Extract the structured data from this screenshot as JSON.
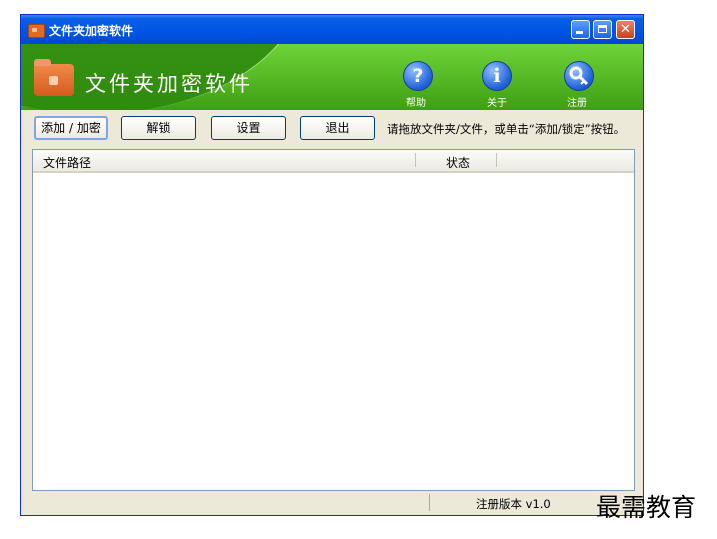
{
  "window": {
    "title": "文件夹加密软件"
  },
  "banner": {
    "title": "文件夹加密软件",
    "help_label": "帮助",
    "about_label": "关于",
    "register_label": "注册"
  },
  "toolbar": {
    "add_encrypt_label": "添加 / 加密",
    "unlock_label": "解锁",
    "settings_label": "设置",
    "exit_label": "退出",
    "hint": "请拖放文件夹/文件，或单击“添加/锁定”按钮。"
  },
  "table": {
    "columns": [
      "文件路径",
      "状态"
    ],
    "rows": []
  },
  "statusbar": {
    "version": "注册版本 v1.0"
  },
  "watermark": "最需教育",
  "colors": {
    "banner_green": "#4caf1f",
    "titlebar_blue": "#0055e5"
  },
  "icons": [
    "folder-app-icon",
    "help-icon",
    "info-icon",
    "key-icon"
  ]
}
